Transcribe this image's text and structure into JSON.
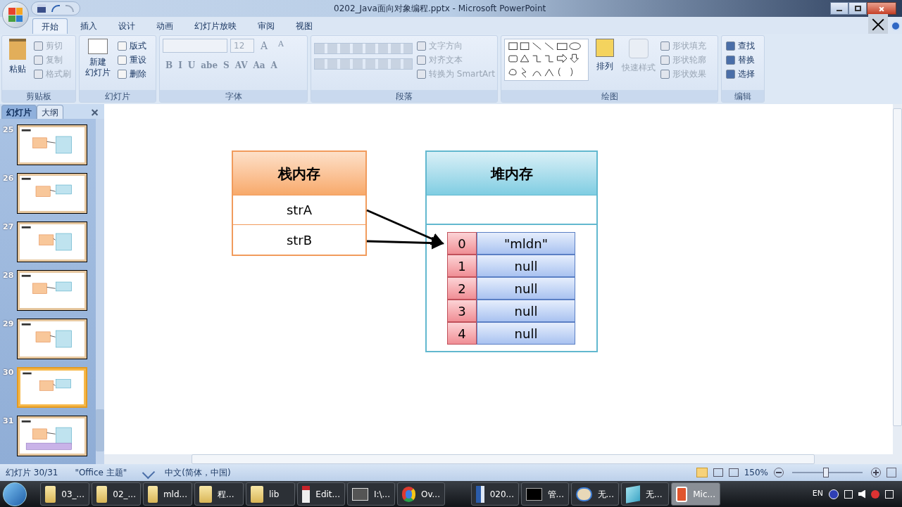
{
  "window": {
    "title": "0202_Java面向对象编程.pptx - Microsoft PowerPoint"
  },
  "ribbon_tabs": [
    {
      "label": "开始",
      "selected": true
    },
    {
      "label": "插入",
      "selected": false
    },
    {
      "label": "设计",
      "selected": false
    },
    {
      "label": "动画",
      "selected": false
    },
    {
      "label": "幻灯片放映",
      "selected": false
    },
    {
      "label": "审阅",
      "selected": false
    },
    {
      "label": "视图",
      "selected": false
    }
  ],
  "clipboard": {
    "title": "剪贴板",
    "paste": "粘贴",
    "items": [
      {
        "label": "剪切",
        "disabled": true
      },
      {
        "label": "复制",
        "disabled": true
      },
      {
        "label": "格式刷",
        "disabled": true
      }
    ]
  },
  "slides_group": {
    "title": "幻灯片",
    "new_slide": [
      "新建",
      "幻灯片"
    ],
    "items": [
      {
        "label": "版式"
      },
      {
        "label": "重设"
      },
      {
        "label": "删除"
      }
    ]
  },
  "font": {
    "title": "字体",
    "size": "12",
    "size_buttons": [
      "A",
      "A"
    ],
    "buttons": [
      "B",
      "I",
      "U",
      "abe",
      "S",
      "AV",
      "Aa",
      "A"
    ]
  },
  "paragraph": {
    "title": "段落",
    "items": [
      {
        "label": "文字方向",
        "disabled": true
      },
      {
        "label": "对齐文本",
        "disabled": true
      },
      {
        "label": "转换为 SmartArt",
        "disabled": true
      }
    ]
  },
  "drawing": {
    "title": "绘图",
    "arrange": "排列",
    "quick_styles": "快速样式",
    "items": [
      {
        "label": "形状填充",
        "disabled": true
      },
      {
        "label": "形状轮廓",
        "disabled": true
      },
      {
        "label": "形状效果",
        "disabled": true
      }
    ]
  },
  "editing": {
    "title": "编辑",
    "items": [
      {
        "label": "查找"
      },
      {
        "label": "替换"
      },
      {
        "label": "选择"
      }
    ]
  },
  "panel_tabs": [
    {
      "label": "幻灯片",
      "selected": true
    },
    {
      "label": "大纲",
      "selected": false
    }
  ],
  "thumbnails": [
    {
      "number": "25",
      "selected": false
    },
    {
      "number": "26",
      "selected": false
    },
    {
      "number": "27",
      "selected": false
    },
    {
      "number": "28",
      "selected": false
    },
    {
      "number": "29",
      "selected": false
    },
    {
      "number": "30",
      "selected": true
    },
    {
      "number": "31",
      "selected": false
    }
  ],
  "slide": {
    "stack": {
      "title": "栈内存",
      "rows": [
        "strA",
        "strB"
      ]
    },
    "heap": {
      "title": "堆内存",
      "array": [
        {
          "index": "0",
          "value": "\"mldn\""
        },
        {
          "index": "1",
          "value": "null"
        },
        {
          "index": "2",
          "value": "null"
        },
        {
          "index": "3",
          "value": "null"
        },
        {
          "index": "4",
          "value": "null"
        }
      ]
    }
  },
  "status_bar": {
    "slide": "幻灯片 30/31",
    "theme": "\"Office 主题\"",
    "language": "中文(简体，中国)",
    "zoom": "150%",
    "zoom_level": {
      "level": 0.48
    }
  },
  "taskbar": [
    {
      "kind": "folder",
      "label": "03_...",
      "selected": false
    },
    {
      "kind": "folder",
      "label": "02_...",
      "selected": false
    },
    {
      "kind": "folder",
      "label": "mld...",
      "selected": false
    },
    {
      "kind": "folder",
      "label": "程...",
      "selected": false
    },
    {
      "kind": "folder",
      "label": "lib",
      "selected": false
    },
    {
      "kind": "editor",
      "label": "Edit...",
      "selected": false
    },
    {
      "kind": "sublime",
      "label": "I:\\...",
      "selected": false
    },
    {
      "kind": "chrome",
      "label": "Ov...",
      "selected": false
    },
    {
      "kind": "word",
      "label": "020...",
      "selected": false
    },
    {
      "kind": "cmd",
      "label": "管...",
      "selected": false
    },
    {
      "kind": "paint",
      "label": "无...",
      "selected": false
    },
    {
      "kind": "notepad",
      "label": "无...",
      "selected": false
    },
    {
      "kind": "ppt",
      "label": "Mic...",
      "selected": true
    }
  ],
  "tray": {
    "language": "EN"
  }
}
